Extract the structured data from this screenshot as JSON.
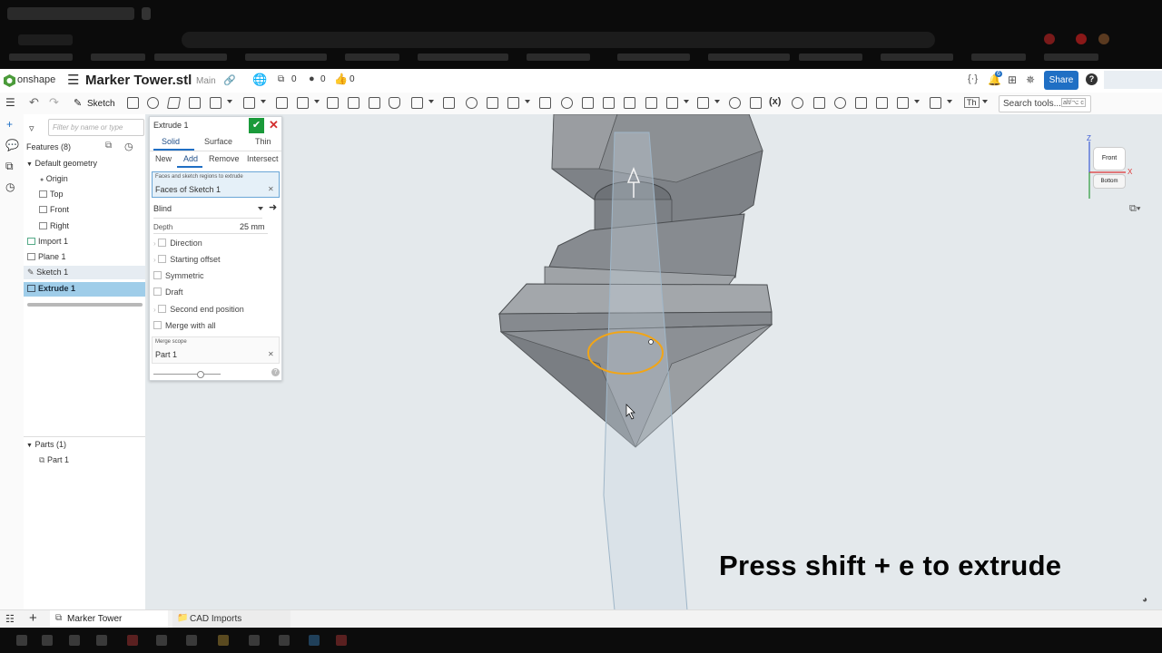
{
  "header": {
    "logo_text": "onshape",
    "doc_title": "Marker Tower.stl",
    "branch": "Main",
    "versions_count": "0",
    "branches_count": "0",
    "likes_count": "0",
    "notification_count": "6",
    "share_label": "Share",
    "help_label": "?"
  },
  "toolbar": {
    "sketch_label": "Sketch",
    "search_placeholder": "Search tools...",
    "search_shortcut": "alt/⌥ c",
    "variable_label": "(x)",
    "th_label": "Th"
  },
  "feature_panel": {
    "filter_placeholder": "Filter by name or type",
    "features_header": "Features (8)",
    "default_geometry": "Default geometry",
    "items": [
      "Origin",
      "Top",
      "Front",
      "Right"
    ],
    "features": [
      "Import 1",
      "Plane 1",
      "Sketch 1",
      "Extrude 1"
    ],
    "parts_header": "Parts (1)",
    "parts": [
      "Part 1"
    ]
  },
  "extrude_dialog": {
    "title": "Extrude 1",
    "type_tabs": [
      "Solid",
      "Surface",
      "Thin"
    ],
    "op_tabs": [
      "New",
      "Add",
      "Remove",
      "Intersect"
    ],
    "selection_label": "Faces and sketch regions to extrude",
    "selection_value": "Faces of Sketch 1",
    "end_type": "Blind",
    "depth_label": "Depth",
    "depth_value": "25 mm",
    "direction_label": "Direction",
    "starting_offset_label": "Starting offset",
    "symmetric_label": "Symmetric",
    "draft_label": "Draft",
    "second_end_label": "Second end position",
    "merge_all_label": "Merge with all",
    "merge_scope_label": "Merge scope",
    "merge_scope_value": "Part 1"
  },
  "view_cube": {
    "front_label": "Front",
    "bottom_label": "Bottom",
    "z_label": "Z",
    "x_label": "X"
  },
  "tabs_bar": {
    "tabs": [
      "Marker Tower",
      "CAD Imports"
    ]
  },
  "caption": "Press shift + e to extrude",
  "colors": {
    "accent": "#1f6fc4",
    "confirm": "#1a9a3a",
    "cancel": "#d32f2f",
    "selection_orange": "#f2a516",
    "model_gray": "#8a8d91"
  }
}
